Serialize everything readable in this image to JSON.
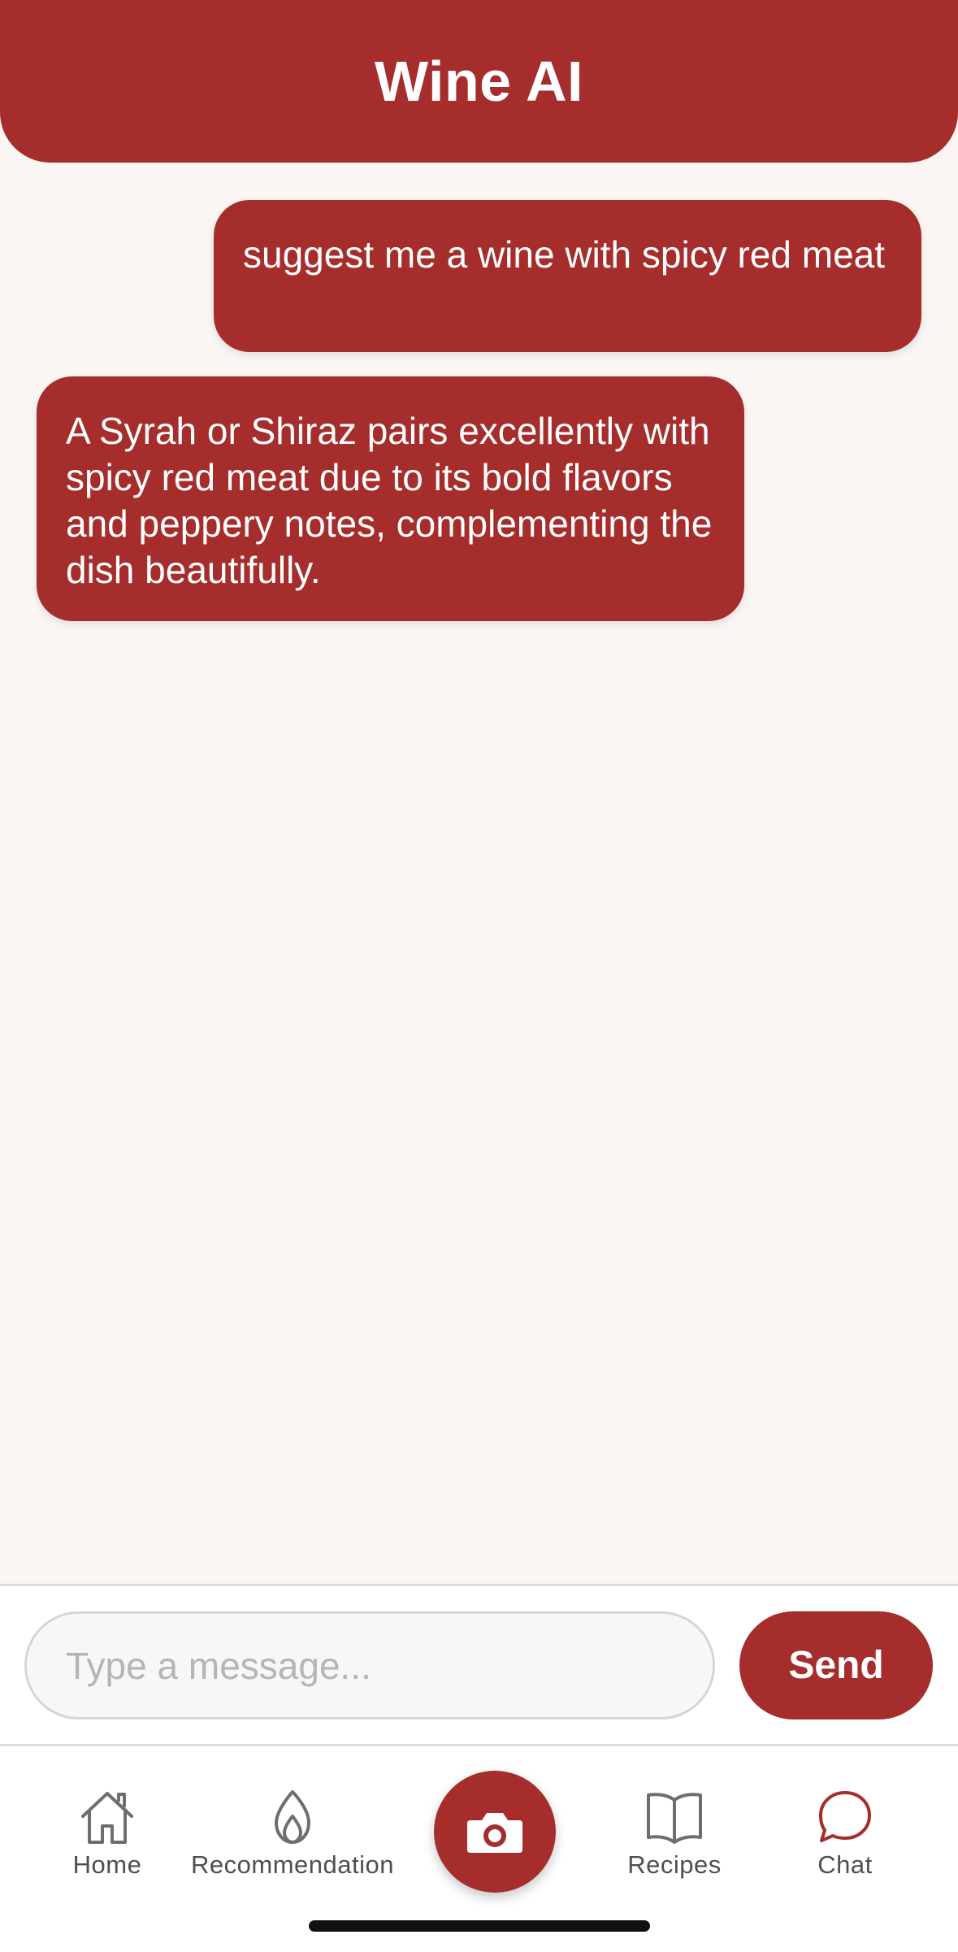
{
  "header": {
    "title": "Wine AI"
  },
  "messages": [
    {
      "sender": "user",
      "text": "suggest me a wine with spicy red meat"
    },
    {
      "sender": "assistant",
      "text": "A Syrah or Shiraz pairs excellently with spicy red meat due to its bold flavors and peppery notes, complementing the dish beautifully."
    }
  ],
  "composer": {
    "placeholder": "Type a message...",
    "value": "",
    "send_label": "Send"
  },
  "tabs": [
    {
      "label": "Home",
      "icon": "home-icon",
      "active": false
    },
    {
      "label": "Recommendation",
      "icon": "flame-icon",
      "active": false
    },
    {
      "label": "",
      "icon": "camera-icon",
      "active": false
    },
    {
      "label": "Recipes",
      "icon": "book-icon",
      "active": false
    },
    {
      "label": "Chat",
      "icon": "chat-bubble-icon",
      "active": true
    }
  ],
  "colors": {
    "brand": "#a52d2c",
    "background": "#fbf6f3",
    "tab_inactive": "#6e6e6e"
  }
}
